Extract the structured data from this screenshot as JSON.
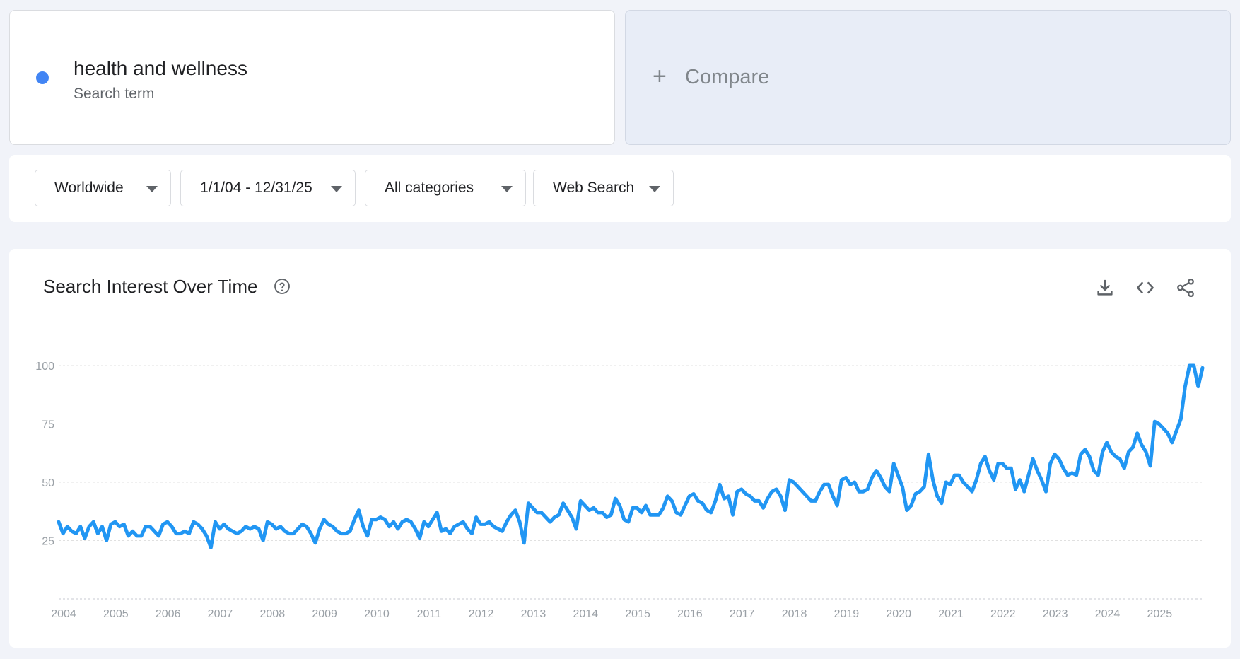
{
  "term": {
    "name": "health and wellness",
    "subtitle": "Search term",
    "color": "#4285f4"
  },
  "compare": {
    "icon": "plus-icon",
    "label": "Compare"
  },
  "filters": {
    "geo": "Worldwide",
    "date_range": "1/1/04 - 12/31/25",
    "category": "All categories",
    "property": "Web Search"
  },
  "chart_header": {
    "title": "Search Interest Over Time",
    "help_icon": "help-circle-icon",
    "actions": [
      "download-icon",
      "embed-code-icon",
      "share-icon"
    ]
  },
  "chart_data": {
    "type": "line",
    "title": "Search Interest Over Time",
    "ylim": [
      0,
      100
    ],
    "yticks": [
      25,
      50,
      75,
      100
    ],
    "x_tick_labels": [
      "2004",
      "2005",
      "2006",
      "2007",
      "2008",
      "2009",
      "2010",
      "2011",
      "2012",
      "2013",
      "2014",
      "2015",
      "2016",
      "2017",
      "2018",
      "2019",
      "2020",
      "2021",
      "2022",
      "2023",
      "2024",
      "2025"
    ],
    "grid": true,
    "line_color": "#2196f3",
    "series": [
      {
        "start": "2004-01",
        "frequency": "monthly",
        "values": [
          33,
          28,
          31,
          29,
          28,
          31,
          26,
          31,
          33,
          28,
          31,
          25,
          32,
          33,
          31,
          32,
          27,
          29,
          27,
          27,
          31,
          31,
          29,
          27,
          32,
          33,
          31,
          28,
          28,
          29,
          28,
          33,
          32,
          30,
          27,
          22,
          33,
          30,
          32,
          30,
          29,
          28,
          29,
          31,
          30,
          31,
          30,
          25,
          33,
          32,
          30,
          31,
          29,
          28,
          28,
          30,
          32,
          31,
          28,
          24,
          30,
          34,
          32,
          31,
          29,
          28,
          28,
          29,
          34,
          38,
          31,
          27,
          34,
          34,
          35,
          34,
          31,
          33,
          30,
          33,
          34,
          33,
          30,
          26,
          33,
          31,
          34,
          37,
          29,
          30,
          28,
          31,
          32,
          33,
          30,
          28,
          35,
          32,
          32,
          33,
          31,
          30,
          29,
          33,
          36,
          38,
          33,
          24,
          41,
          39,
          37,
          37,
          35,
          33,
          35,
          36,
          41,
          38,
          35,
          30,
          42,
          40,
          38,
          39,
          37,
          37,
          35,
          36,
          43,
          40,
          34,
          33,
          39,
          39,
          37,
          40,
          36,
          36,
          36,
          39,
          44,
          42,
          37,
          36,
          40,
          44,
          45,
          42,
          41,
          38,
          37,
          42,
          49,
          43,
          44,
          36,
          46,
          47,
          45,
          44,
          42,
          42,
          39,
          43,
          46,
          47,
          44,
          38,
          51,
          50,
          48,
          46,
          44,
          42,
          42,
          46,
          49,
          49,
          44,
          40,
          51,
          52,
          49,
          50,
          46,
          46,
          47,
          52,
          55,
          52,
          48,
          46,
          58,
          53,
          48,
          38,
          40,
          45,
          46,
          48,
          62,
          51,
          44,
          41,
          50,
          49,
          53,
          53,
          50,
          48,
          46,
          51,
          58,
          61,
          55,
          51,
          58,
          58,
          56,
          56,
          47,
          51,
          46,
          53,
          60,
          55,
          51,
          46,
          58,
          62,
          60,
          56,
          53,
          54,
          53,
          62,
          64,
          61,
          55,
          53,
          63,
          67,
          63,
          61,
          60,
          56,
          63,
          65,
          71,
          66,
          63,
          57,
          76,
          75,
          73,
          71,
          67,
          72,
          77,
          91,
          100,
          100,
          91,
          99
        ]
      }
    ]
  }
}
